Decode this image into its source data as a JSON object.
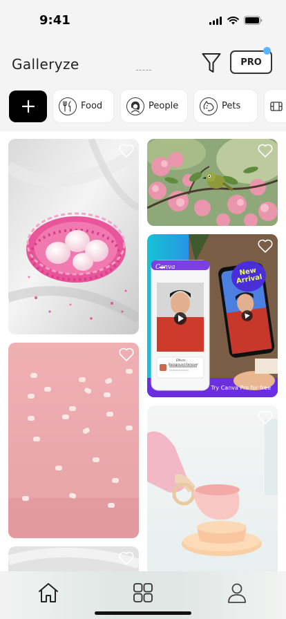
{
  "status_bar": {
    "time": "9:41",
    "icons": [
      "cellular-signal-icon",
      "wifi-icon",
      "battery-icon"
    ]
  },
  "header": {
    "app_title": "Galleryze",
    "filter_icon": "filter-funnel-icon",
    "pro_label": "PRO",
    "pro_notification_color": "#5bb4ff"
  },
  "categories": {
    "add_icon": "plus-icon",
    "items": [
      {
        "label": "Food",
        "icon": "fork-knife-icon"
      },
      {
        "label": "People",
        "icon": "person-icon"
      },
      {
        "label": "Pets",
        "icon": "pet-icon"
      },
      {
        "label": "",
        "icon": "film-icon"
      }
    ]
  },
  "gallery": {
    "items": [
      {
        "subject": "pink eggs in nest",
        "favorite": false
      },
      {
        "subject": "bird on blossom branch",
        "favorite": false
      },
      {
        "subject": "canva promo",
        "favorite": false,
        "ad": {
          "brand": "Canva",
          "bubble": "New Arrival",
          "cta": "Try Canva Pro for free",
          "panel_title": "Effects",
          "panel_item": "Background Remover"
        }
      },
      {
        "subject": "scattered pink candies",
        "favorite": false
      },
      {
        "subject": "pink ceramic cup",
        "favorite": false
      },
      {
        "subject": "white fabric",
        "favorite": false
      }
    ]
  },
  "bottom_nav": {
    "items": [
      {
        "icon": "home-icon",
        "active": true
      },
      {
        "icon": "grid-icon",
        "active": false
      },
      {
        "icon": "profile-icon",
        "active": false
      }
    ]
  },
  "colors": {
    "accent": "#000000",
    "header_bg": "#f4f4f4",
    "canva_purple": "#6b2fe0",
    "canva_teal": "#18bfd0"
  }
}
